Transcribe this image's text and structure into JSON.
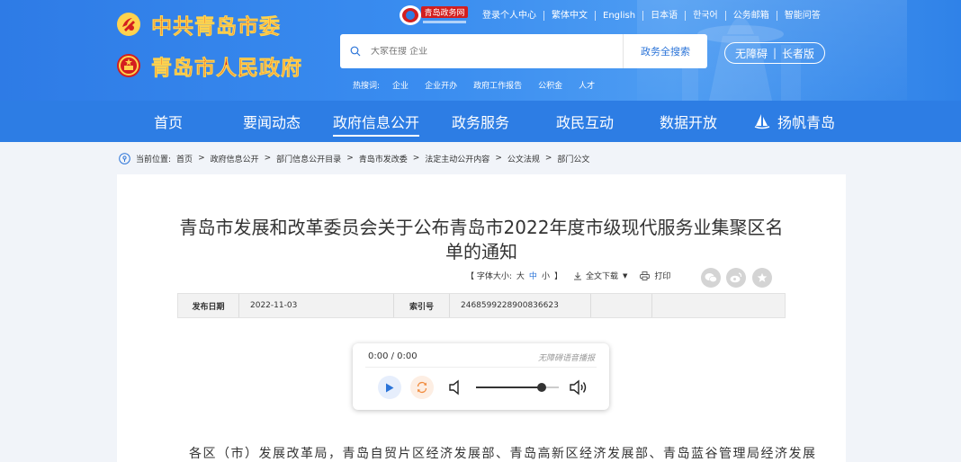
{
  "header": {
    "org1": "中共青岛市委",
    "org2": "青岛市人民政府",
    "gov_logo_text": "青岛政务网",
    "top_links": [
      "登录个人中心",
      "繁体中文",
      "English",
      "日本语",
      "한국어",
      "公务邮箱",
      "智能问答"
    ],
    "search": {
      "placeholder": "大家在搜 企业",
      "button": "政务全搜索"
    },
    "access": {
      "barrier_free": "无障碍",
      "elderly": "长者版"
    },
    "hot": {
      "label": "热搜词:",
      "words": [
        "企业",
        "企业开办",
        "政府工作报告",
        "公积金",
        "人才"
      ]
    }
  },
  "nav": {
    "items": [
      "首页",
      "要闻动态",
      "政府信息公开",
      "政务服务",
      "政民互动",
      "数据开放",
      "扬帆青岛"
    ],
    "active_index": 2
  },
  "breadcrumb": {
    "label": "当前位置:",
    "items": [
      "首页",
      "政府信息公开",
      "部门信息公开目录",
      "青岛市发改委",
      "法定主动公开内容",
      "公文法规",
      "部门公文"
    ]
  },
  "article": {
    "title": "青岛市发展和改革委员会关于公布青岛市2022年度市级现代服务业集聚区名单的通知",
    "tools": {
      "font_label": "【 字体大小:",
      "sizes": [
        "大",
        "中",
        "小"
      ],
      "close": "】",
      "download": "全文下载",
      "print": "打印"
    },
    "meta": {
      "date_label": "发布日期",
      "date": "2022-11-03",
      "index_label": "索引号",
      "index": "2468599228900836623"
    },
    "player": {
      "time": "0:00 / 0:00",
      "tag": "无障碍语音播报",
      "volume": 0.8
    },
    "body_first_line": "各区（市）发展改革局，青岛自贸片区经济发展部、青岛高新区经济发展部、青岛蓝谷管理局经济发展"
  },
  "colors": {
    "nav_blue": "#2d7de4",
    "header_blue": "#3a8df0",
    "logo_red": "#d31f1f",
    "link_blue": "#2b74d8"
  }
}
